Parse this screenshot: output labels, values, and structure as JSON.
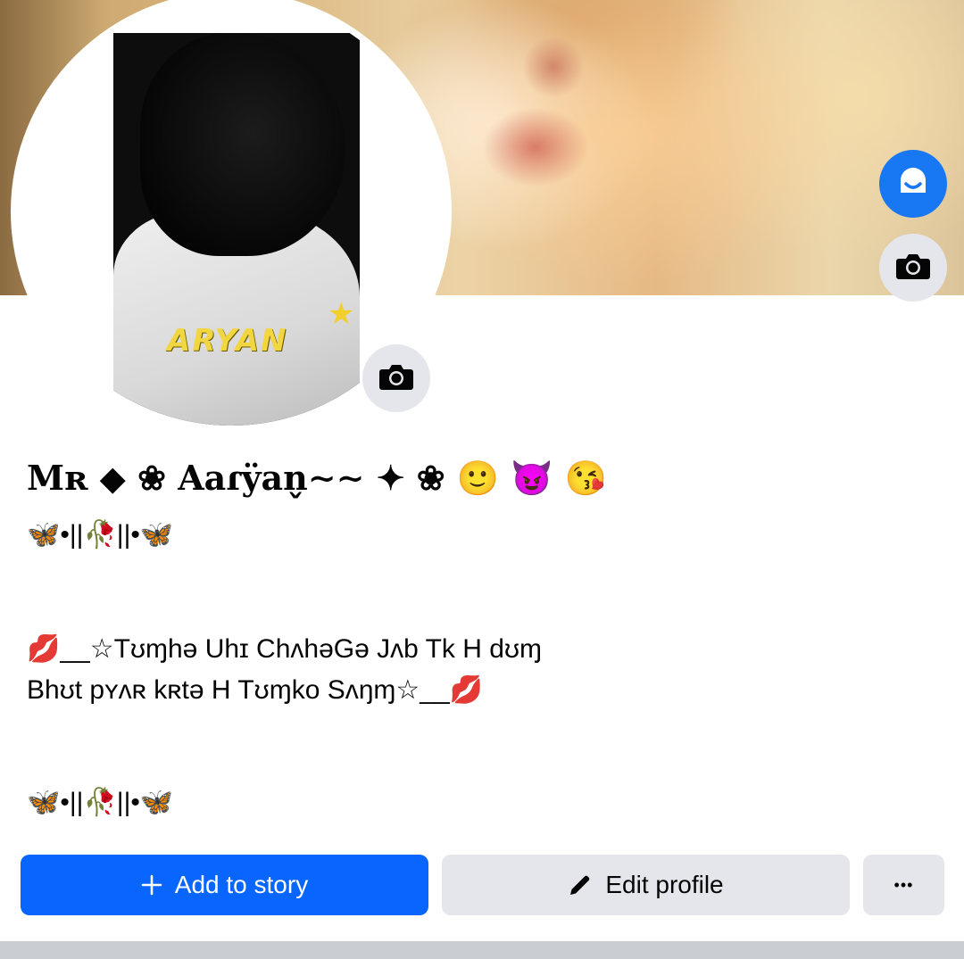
{
  "profile": {
    "name": "Mʀ⁠ ◆ ❀ Aaɾÿan̬∼∼ ✦ ❀ 🙂 😈 😘",
    "bio_line_1": "🦋•||🥀||•🦋",
    "bio_line_2": "💋__☆Tʊɱhə Uhɪ ChʌhəGə Jʌb Tk H dʊɱ",
    "bio_line_3": "Bhʊt pʏʌʀ kʀtə H Tʊɱko Sʌŋɱ☆__💋",
    "bio_line_4": "🦋•||🥀||•🦋",
    "picture_logo_text": "ARYAN"
  },
  "actions": {
    "add_to_story_label": "Add to story",
    "edit_profile_label": "Edit profile",
    "more_label": "•••"
  },
  "icons": {
    "avatar_button": "avatar-icon",
    "cover_camera": "camera-icon",
    "profile_camera": "camera-icon",
    "add_to_story": "plus-icon",
    "edit_profile": "pencil-icon",
    "more": "more-icon"
  },
  "colors": {
    "primary": "#0866ff",
    "secondary_button": "#e4e6eb",
    "avatar_button": "#1877f2"
  }
}
